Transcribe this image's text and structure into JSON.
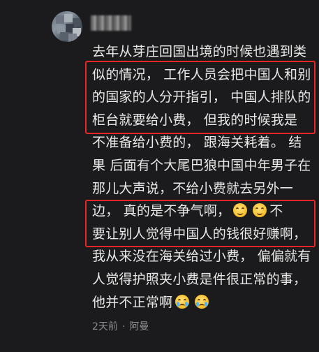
{
  "comment": {
    "username": "",
    "lines": [
      [
        "去年从芽庄回国出境的时候也遇到类"
      ],
      [
        "似的情况，  工作人员会把中国人和别"
      ],
      [
        "的国家的人分开指引，  中国人排队的"
      ],
      [
        "柜台就要给小费，  但我的时候我是"
      ],
      [
        "不准备给小费的，  跟海关耗着。  结"
      ],
      [
        "果 后面有个大尾巴狼中国中年男子在"
      ],
      [
        "那儿大声说，不给小费就去另外一"
      ],
      [
        "边，  真的是不争气啊，",
        "smile",
        "smile",
        "不"
      ],
      [
        "要让别人觉得中国人的钱很好赚啊，"
      ],
      [
        "我从来没在海关给过小费，  偏偏就有"
      ],
      [
        "人觉得护照夹小费是件很正常的事，"
      ],
      [
        "他并不正常啊",
        "cry",
        "cry"
      ]
    ],
    "meta": {
      "time": "2天前",
      "separator": "·",
      "location": "阿曼"
    },
    "highlight_color": "#e8262a"
  }
}
